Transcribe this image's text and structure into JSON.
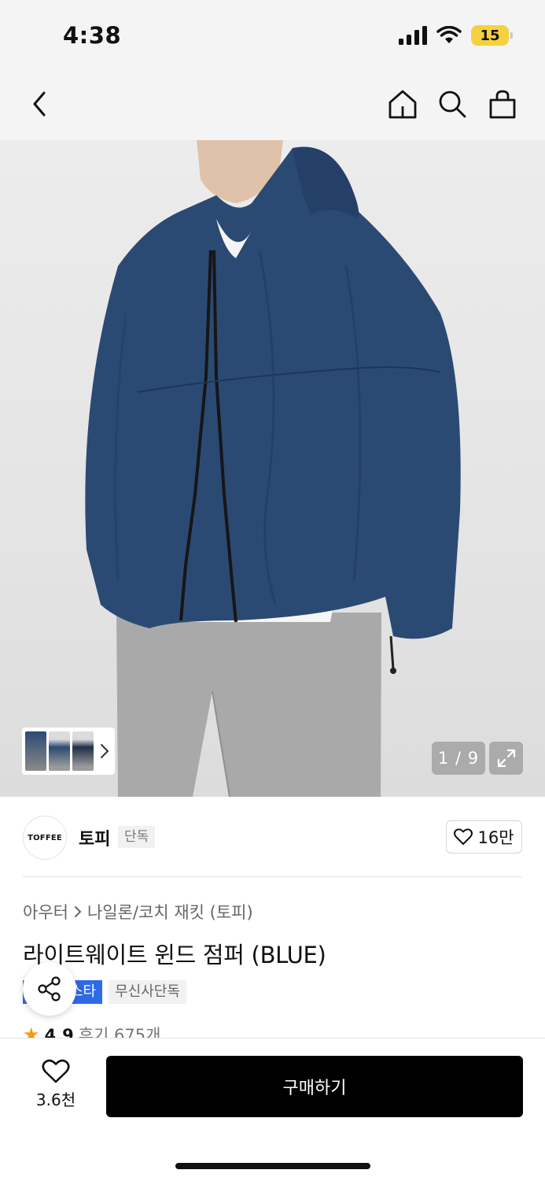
{
  "status_bar": {
    "time": "4:38",
    "battery": "15"
  },
  "nav": {
    "back_icon": "chevron-left-icon",
    "home_icon": "home-icon",
    "search_icon": "search-icon",
    "bag_icon": "shopping-bag-icon"
  },
  "gallery": {
    "counter": "1 / 9"
  },
  "brand": {
    "logo_text": "TOFFEE",
    "name": "토피",
    "badge": "단독",
    "likes": "16만"
  },
  "product": {
    "breadcrumb": {
      "category": "아우터",
      "subcategory": "나일론/코치 재킷 (토피)"
    },
    "title": "라이트웨이트 윈드 점퍼 (BLUE)",
    "tags": [
      {
        "label": "스타",
        "color": "#2d6ae8"
      },
      {
        "label": "무신사단독",
        "color": "#f1f1f1"
      }
    ],
    "rating": {
      "score": "4.9",
      "reviews": "후기 675개"
    }
  },
  "bottom_bar": {
    "wish_count": "3.6천",
    "buy_label": "구매하기"
  },
  "colors": {
    "accent_blue": "#2d6ae8",
    "buy_button": "#000000",
    "battery": "#f5d142"
  }
}
